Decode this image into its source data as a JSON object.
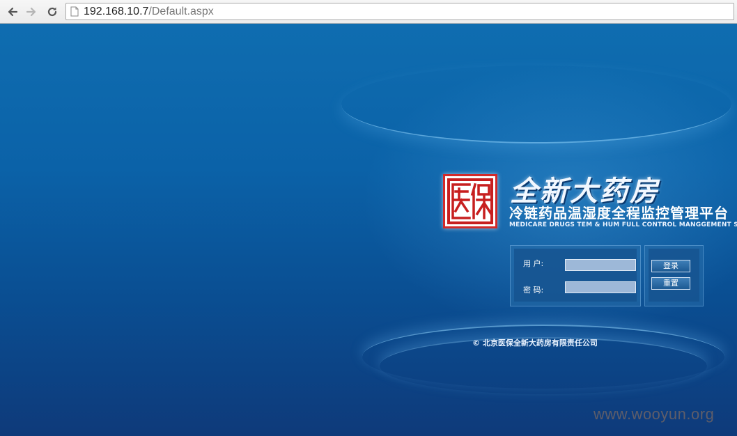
{
  "browser": {
    "url_host": "192.168.10.7",
    "url_path": "/Default.aspx"
  },
  "logo": {
    "seal_text": "医保",
    "brand_name": "全新大药房",
    "subtitle": "冷链药品温湿度全程监控管理平台",
    "english": "MEDICARE DRUGS TEM & HUM FULL CONTROL MANGGEMENT SYSTEM"
  },
  "login": {
    "username_label": "用 户:",
    "password_label": "密 码:",
    "username_value": "",
    "password_value": ""
  },
  "buttons": {
    "login_label": "登录",
    "reset_label": "重置"
  },
  "footer": {
    "copyright": "© 北京医保全新大药房有限责任公司"
  },
  "watermark": "www.wooyun.org",
  "colors": {
    "background": "#0b62a8",
    "seal_red": "#d22a2a",
    "input_bg": "#9db8d8"
  }
}
